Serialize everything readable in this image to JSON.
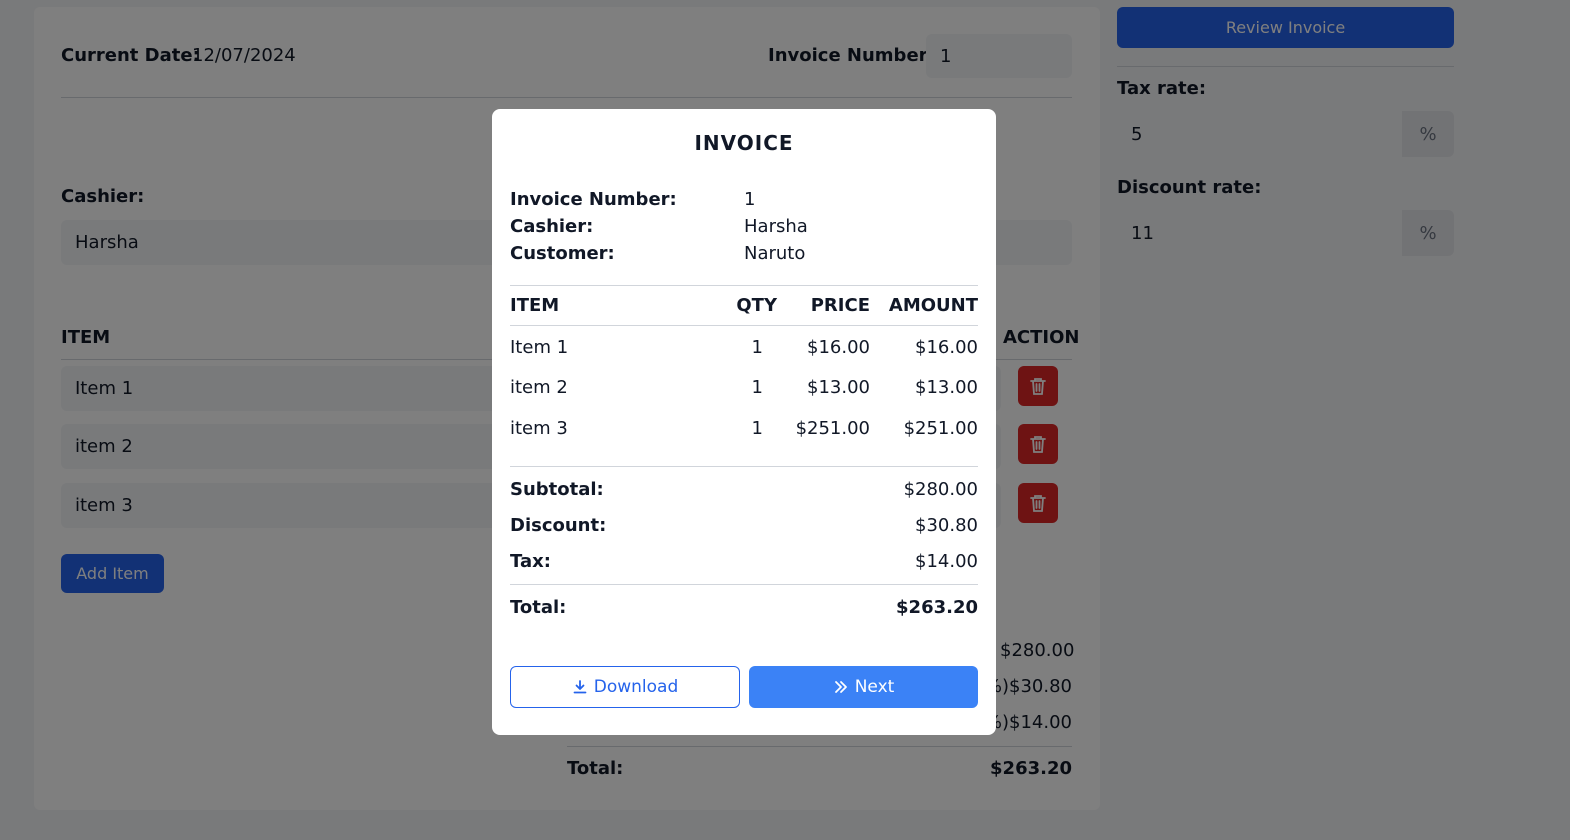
{
  "form": {
    "current_date_label": "Current Date:",
    "current_date_value": "12/07/2024",
    "invoice_number_label": "Invoice Number:",
    "invoice_number_value": "1",
    "cashier_label": "Cashier:",
    "cashier_value": "Harsha",
    "item_header": "ITEM",
    "action_header": "ACTION",
    "items": [
      {
        "name": "Item 1"
      },
      {
        "name": "item 2"
      },
      {
        "name": "item 3"
      }
    ],
    "add_item_label": "Add Item",
    "subtotal_value": "$280.00",
    "discount_value": "%)$30.80",
    "tax_value": "%)$14.00",
    "total_label": "Total:",
    "total_value": "$263.20"
  },
  "sidebar": {
    "review_label": "Review Invoice",
    "tax_rate_label": "Tax rate:",
    "tax_rate_value": "5",
    "discount_rate_label": "Discount rate:",
    "discount_rate_value": "11",
    "percent_symbol": "%"
  },
  "modal": {
    "title": "INVOICE",
    "invoice_number_label": "Invoice Number:",
    "invoice_number_value": "1",
    "cashier_label": "Cashier:",
    "cashier_value": "Harsha",
    "customer_label": "Customer:",
    "customer_value": "Naruto",
    "columns": [
      "ITEM",
      "QTY",
      "PRICE",
      "AMOUNT"
    ],
    "rows": [
      {
        "item": "Item 1",
        "qty": "1",
        "price": "$16.00",
        "amount": "$16.00"
      },
      {
        "item": "item 2",
        "qty": "1",
        "price": "$13.00",
        "amount": "$13.00"
      },
      {
        "item": "item 3",
        "qty": "1",
        "price": "$251.00",
        "amount": "$251.00"
      }
    ],
    "subtotal_label": "Subtotal:",
    "subtotal_value": "$280.00",
    "discount_label": "Discount:",
    "discount_value": "$30.80",
    "tax_label": "Tax:",
    "tax_value": "$14.00",
    "total_label": "Total:",
    "total_value": "$263.20",
    "download_label": "Download",
    "next_label": "Next"
  },
  "colors": {
    "primary": "#2563eb",
    "danger": "#dc2626",
    "next_button": "#3b82f6"
  },
  "icons": {
    "trash": "trash-icon",
    "download": "download-icon",
    "next": "double-chevron-right-icon"
  }
}
